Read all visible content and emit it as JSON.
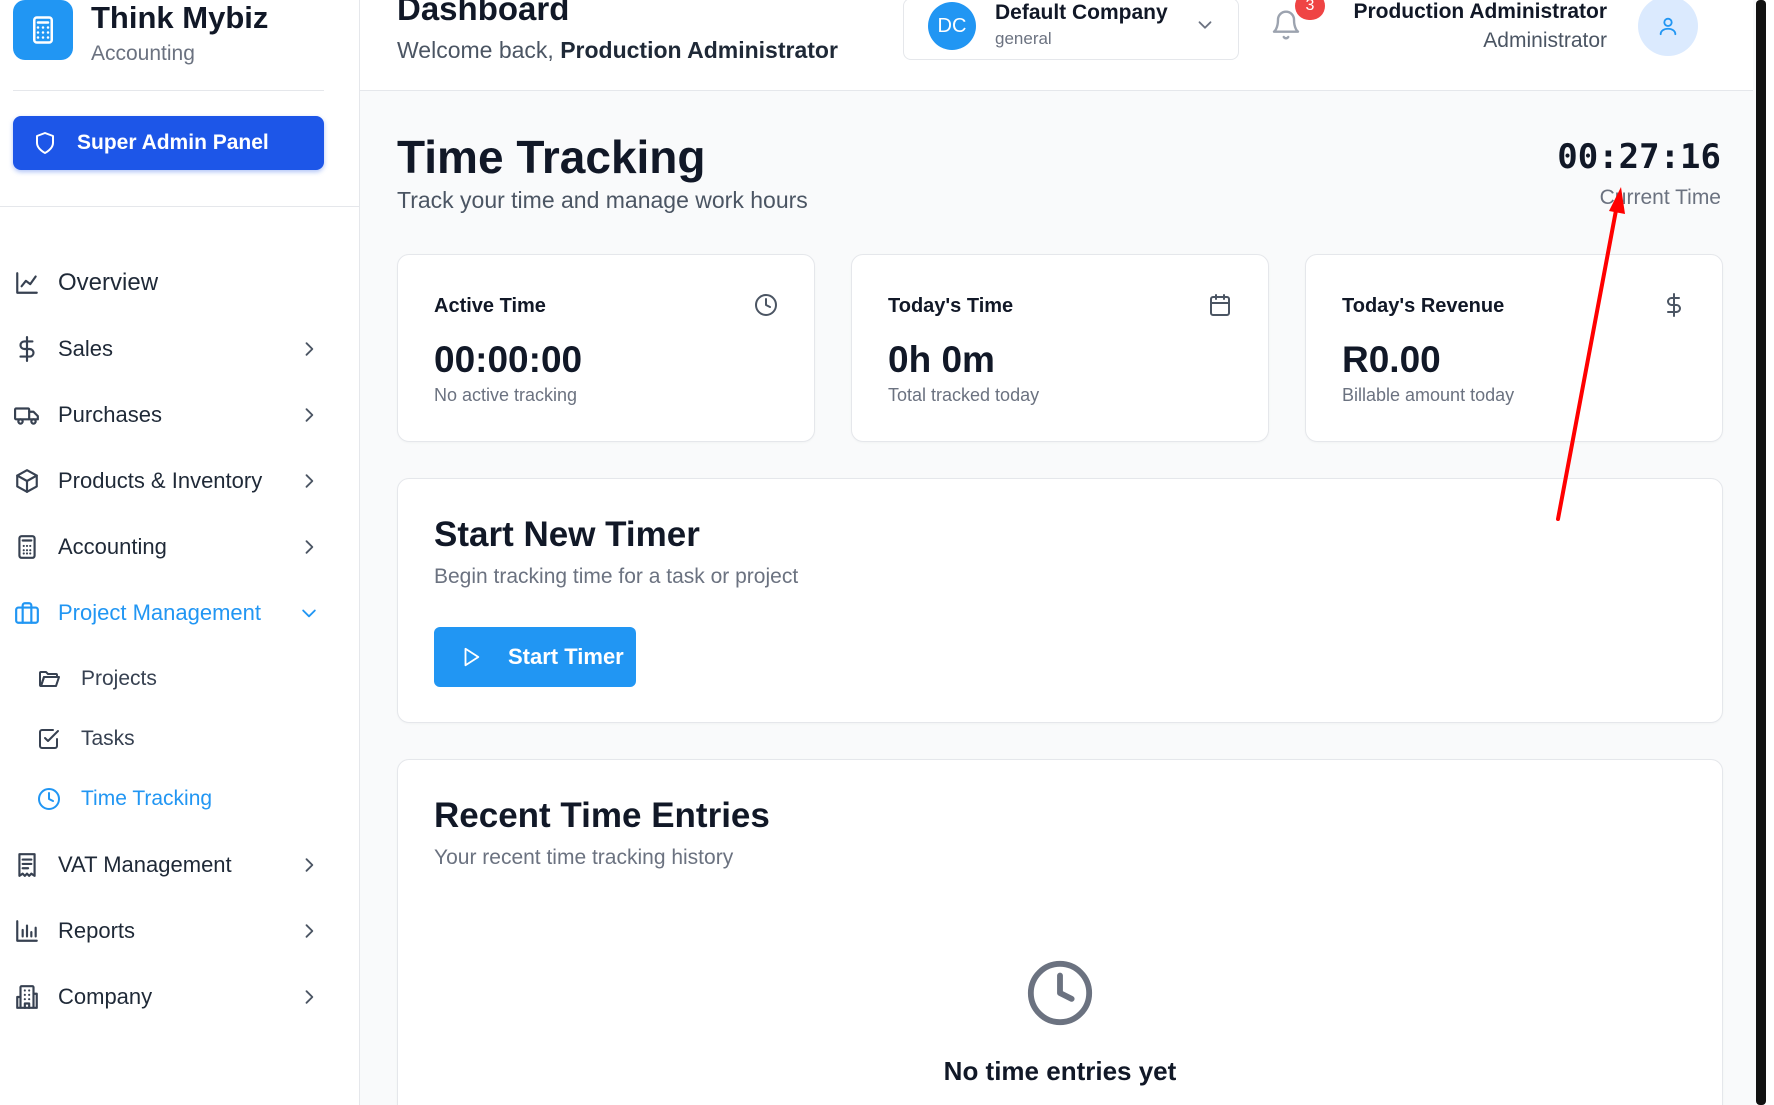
{
  "brand": {
    "name": "Think Mybiz",
    "subtitle": "Accounting"
  },
  "sidebar": {
    "admin_button": "Super Admin Panel",
    "items": [
      {
        "label": "Overview",
        "icon": "line-chart-icon",
        "has_children": false
      },
      {
        "label": "Sales",
        "icon": "dollar-icon",
        "has_children": true
      },
      {
        "label": "Purchases",
        "icon": "truck-icon",
        "has_children": true
      },
      {
        "label": "Products & Inventory",
        "icon": "package-icon",
        "has_children": true
      },
      {
        "label": "Accounting",
        "icon": "calculator-icon",
        "has_children": true
      },
      {
        "label": "Project Management",
        "icon": "briefcase-icon",
        "has_children": true,
        "expanded": true,
        "active": true
      },
      {
        "label": "VAT Management",
        "icon": "receipt-icon",
        "has_children": true
      },
      {
        "label": "Reports",
        "icon": "bar-chart-icon",
        "has_children": true
      },
      {
        "label": "Company",
        "icon": "building-icon",
        "has_children": true
      }
    ],
    "sub_items": [
      {
        "label": "Projects",
        "icon": "folder-icon"
      },
      {
        "label": "Tasks",
        "icon": "checkbox-icon"
      },
      {
        "label": "Time Tracking",
        "icon": "clock-icon",
        "active": true
      }
    ]
  },
  "header": {
    "title": "Dashboard",
    "welcome_prefix": "Welcome back,",
    "welcome_name": "Production Administrator",
    "company": {
      "initials": "DC",
      "name": "Default Company",
      "sub": "general"
    },
    "notifications_count": "3",
    "user": {
      "name": "Production Administrator",
      "role": "Administrator"
    }
  },
  "main": {
    "title": "Time Tracking",
    "subtitle": "Track your time and manage work hours",
    "clock": "00:27:16",
    "clock_label": "Current Time",
    "stats": [
      {
        "label": "Active Time",
        "value": "00:00:00",
        "sub": "No active tracking",
        "icon": "clock-icon"
      },
      {
        "label": "Today's Time",
        "value": "0h 0m",
        "sub": "Total tracked today",
        "icon": "calendar-icon"
      },
      {
        "label": "Today's Revenue",
        "value": "R0.00",
        "sub": "Billable amount today",
        "icon": "dollar-icon"
      }
    ],
    "new_timer": {
      "title": "Start New Timer",
      "subtitle": "Begin tracking time for a task or project",
      "button": "Start Timer"
    },
    "recent": {
      "title": "Recent Time Entries",
      "subtitle": "Your recent time tracking history",
      "empty": "No time entries yet"
    }
  },
  "colors": {
    "accent": "#2196f3",
    "admin_button": "#1d56e8",
    "badge": "#ef4444",
    "annotation_arrow": "#ff0000"
  }
}
